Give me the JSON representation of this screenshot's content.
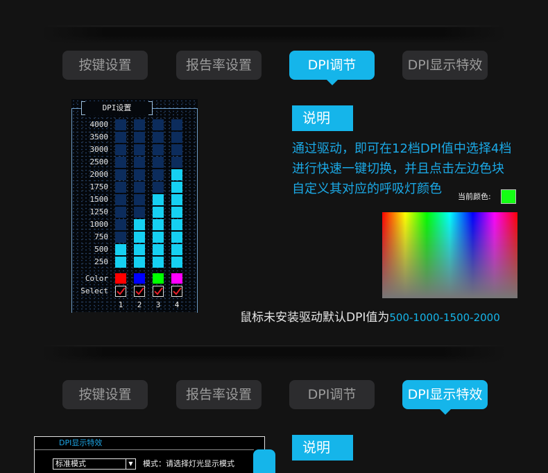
{
  "colors": {
    "accent": "#15b5ea",
    "tab_inactive": "#2c2c2e",
    "cell_on": "#16d0f2",
    "cell_off": "#0c2c5c"
  },
  "tabs_top": [
    {
      "label": "按键设置",
      "active": false
    },
    {
      "label": "报告率设置",
      "active": false
    },
    {
      "label": "DPI调节",
      "active": true
    },
    {
      "label": "DPI显示特效",
      "active": false
    }
  ],
  "dpi_panel": {
    "title": "DPI设置",
    "levels": [
      "4000",
      "3500",
      "3000",
      "2500",
      "2000",
      "1750",
      "1500",
      "1250",
      "1000",
      "750",
      "500",
      "250"
    ],
    "color_label": "Color",
    "select_label": "Select",
    "slots": [
      {
        "number": "1",
        "dpi": 500,
        "color": "#ff0000",
        "selected": true
      },
      {
        "number": "2",
        "dpi": 1000,
        "color": "#0000ff",
        "selected": true
      },
      {
        "number": "3",
        "dpi": 1500,
        "color": "#00ff00",
        "selected": true
      },
      {
        "number": "4",
        "dpi": 2000,
        "color": "#ff00ff",
        "selected": true
      }
    ]
  },
  "description": {
    "heading": "说明",
    "lines": [
      "通过驱动，即可在12档DPI值中选择4档",
      "进行快速一键切换，并且点击左边色块",
      "自定义其对应的呼吸灯颜色"
    ],
    "current_color_label": "当前颜色:",
    "current_color": "#14ff14"
  },
  "default_note": {
    "prefix": "鼠标未安装驱动默认DPI值为",
    "values": "500-1000-1500-2000"
  },
  "tabs_bottom": [
    {
      "label": "按键设置",
      "active": false
    },
    {
      "label": "报告率设置",
      "active": false
    },
    {
      "label": "DPI调节",
      "active": false
    },
    {
      "label": "DPI显示特效",
      "active": true
    }
  ],
  "effect_panel": {
    "title": "DPI显示特效",
    "mode_selected": "标准模式",
    "mode_hint": "模式：请选择灯光显示模式"
  },
  "description_bottom": {
    "heading": "说明"
  }
}
